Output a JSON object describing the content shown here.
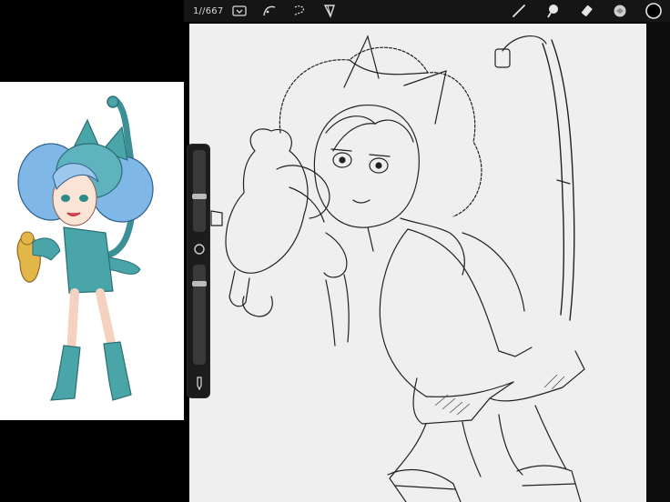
{
  "toolbar": {
    "frame_counter": "1//667",
    "left_icons": [
      "gallery-actions-icon",
      "adjustments-icon",
      "selection-icon",
      "transform-icon"
    ],
    "right_icons": [
      "brush-icon",
      "smudge-icon",
      "eraser-icon",
      "layers-icon",
      "color-swatch-icon"
    ]
  },
  "side_toolbar": {
    "brush_size_level": 0.45,
    "opacity_level": 0.15
  },
  "colors": {
    "toolbar_bg": "#151515",
    "canvas_bg": "#efefef",
    "reference_bg": "#ffffff",
    "hair_blue": "#7fb7e6",
    "outfit_teal": "#4aa5a8",
    "toy_yellow": "#e2b648"
  }
}
